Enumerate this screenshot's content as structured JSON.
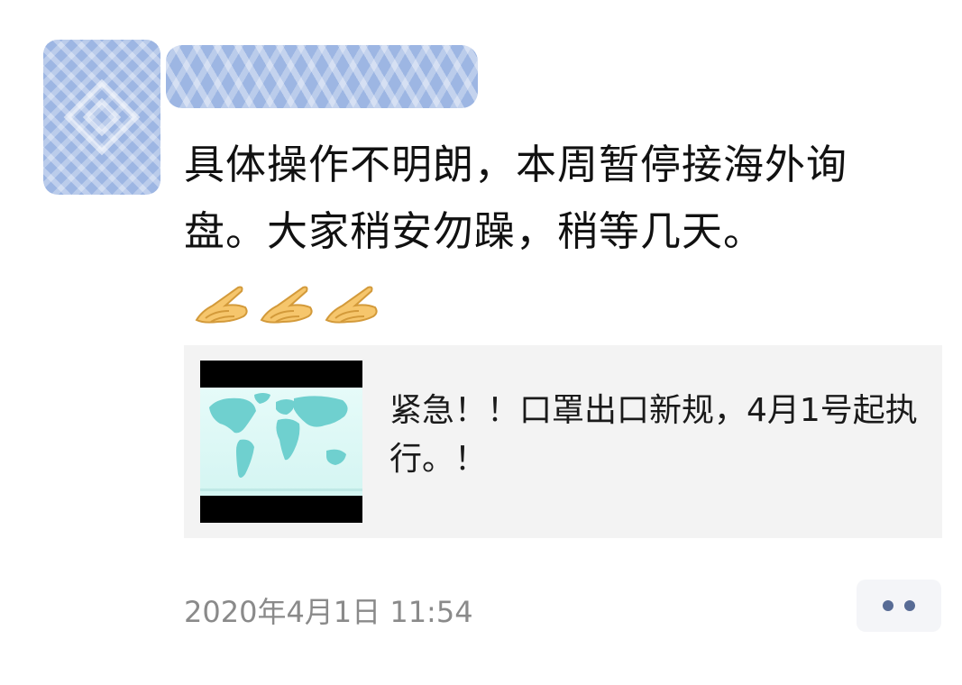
{
  "post": {
    "text": "具体操作不明朗，本周暂停接海外询盘。大家稍安勿躁，稍等几天。",
    "emoji": [
      "clap-hands-icon",
      "clap-hands-icon",
      "clap-hands-icon"
    ]
  },
  "link_card": {
    "title": "紧急！！口罩出口新规，4月1号起执行。！",
    "thumbnail_icon": "world-map-icon"
  },
  "footer": {
    "timestamp": "2020年4月1日 11:54",
    "more_icon": "more-dots-icon"
  },
  "colors": {
    "accent": "#576b95",
    "card_bg": "#f3f3f3",
    "timestamp": "#8a8a8a",
    "blur": "#9db6e3"
  }
}
